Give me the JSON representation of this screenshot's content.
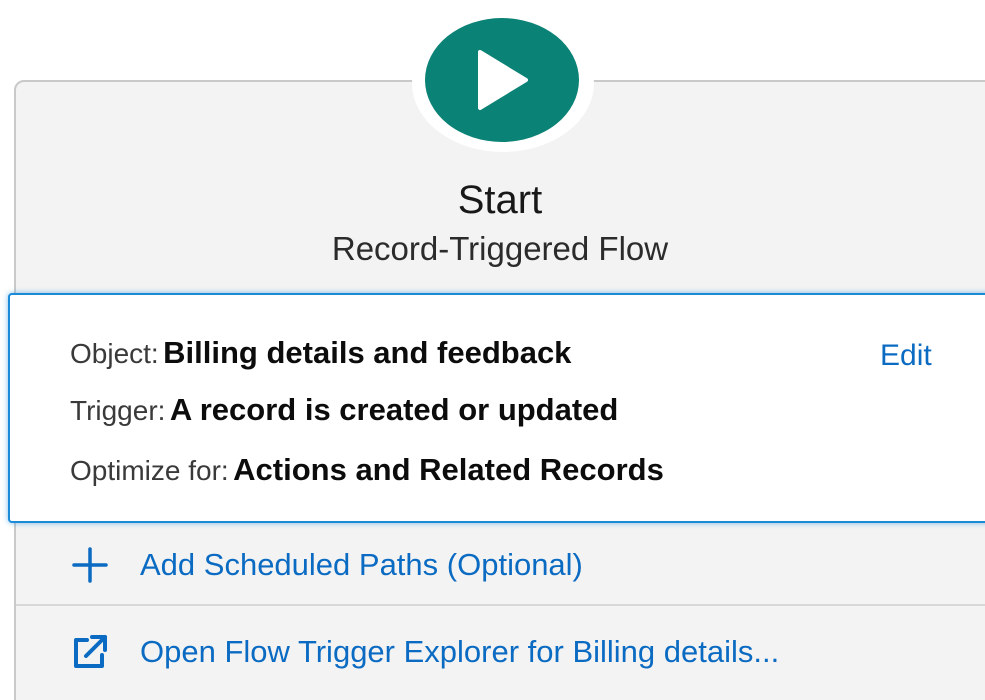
{
  "start": {
    "icon": "play-icon",
    "title": "Start",
    "subtitle": "Record-Triggered Flow"
  },
  "config": {
    "object_label": "Object:",
    "object_value": "Billing details and feedback",
    "trigger_label": "Trigger:",
    "trigger_value": "A record is created or updated",
    "optimize_label": "Optimize for:",
    "optimize_value": "Actions and Related Records",
    "edit_label": "Edit"
  },
  "actions": {
    "scheduled_paths": {
      "icon": "plus-icon",
      "label": "Add Scheduled Paths (Optional)"
    },
    "trigger_explorer": {
      "icon": "external-link-icon",
      "label": "Open Flow Trigger Explorer for Billing details..."
    }
  },
  "colors": {
    "start_button": "#0b8276",
    "link": "#0b6bc2",
    "selection_border": "#1b8bd8",
    "card_background": "#f3f3f3"
  }
}
